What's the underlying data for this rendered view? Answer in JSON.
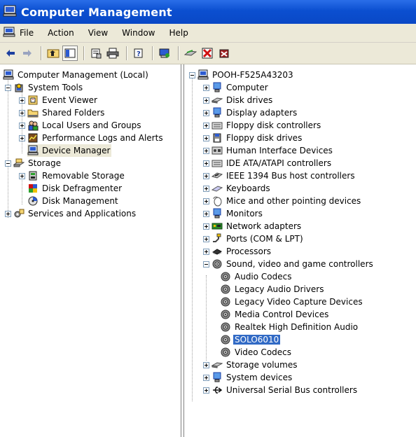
{
  "window": {
    "title": "Computer Management"
  },
  "menu": [
    "File",
    "Action",
    "View",
    "Window",
    "Help"
  ],
  "left_tree": [
    {
      "label": "Computer Management (Local)",
      "icon": "computer-icon",
      "expander": "none"
    },
    {
      "label": "System Tools",
      "icon": "system-tools-icon",
      "expander": "minus"
    },
    {
      "label": "Event Viewer",
      "icon": "event-viewer-icon",
      "expander": "plus"
    },
    {
      "label": "Shared Folders",
      "icon": "folder-icon",
      "expander": "plus"
    },
    {
      "label": "Local Users and Groups",
      "icon": "users-icon",
      "expander": "plus"
    },
    {
      "label": "Performance Logs and Alerts",
      "icon": "performance-icon",
      "expander": "plus"
    },
    {
      "label": "Device Manager",
      "icon": "device-manager-icon",
      "expander": "none",
      "selected": true
    },
    {
      "label": "Storage",
      "icon": "storage-icon",
      "expander": "minus"
    },
    {
      "label": "Removable Storage",
      "icon": "removable-storage-icon",
      "expander": "plus"
    },
    {
      "label": "Disk Defragmenter",
      "icon": "defrag-icon",
      "expander": "none"
    },
    {
      "label": "Disk Management",
      "icon": "disk-management-icon",
      "expander": "none"
    },
    {
      "label": "Services and Applications",
      "icon": "services-icon",
      "expander": "plus"
    }
  ],
  "right_tree": [
    {
      "label": "POOH-F525A43203",
      "icon": "computer-icon",
      "expander": "minus"
    },
    {
      "label": "Computer",
      "icon": "computer-icon",
      "expander": "plus"
    },
    {
      "label": "Disk drives",
      "icon": "disk-drive-icon",
      "expander": "plus"
    },
    {
      "label": "Display adapters",
      "icon": "display-icon",
      "expander": "plus"
    },
    {
      "label": "Floppy disk controllers",
      "icon": "controller-icon",
      "expander": "plus"
    },
    {
      "label": "Floppy disk drives",
      "icon": "floppy-icon",
      "expander": "plus"
    },
    {
      "label": "Human Interface Devices",
      "icon": "hid-icon",
      "expander": "plus"
    },
    {
      "label": "IDE ATA/ATAPI controllers",
      "icon": "controller-icon",
      "expander": "plus"
    },
    {
      "label": "IEEE 1394 Bus host controllers",
      "icon": "ieee-icon",
      "expander": "plus"
    },
    {
      "label": "Keyboards",
      "icon": "keyboard-icon",
      "expander": "plus"
    },
    {
      "label": "Mice and other pointing devices",
      "icon": "mouse-icon",
      "expander": "plus"
    },
    {
      "label": "Monitors",
      "icon": "monitor-icon",
      "expander": "plus"
    },
    {
      "label": "Network adapters",
      "icon": "network-icon",
      "expander": "plus"
    },
    {
      "label": "Ports (COM & LPT)",
      "icon": "port-icon",
      "expander": "plus"
    },
    {
      "label": "Processors",
      "icon": "processor-icon",
      "expander": "plus"
    },
    {
      "label": "Sound, video and game controllers",
      "icon": "speaker-icon",
      "expander": "minus"
    },
    {
      "label": "Audio Codecs",
      "icon": "speaker-icon",
      "expander": "none"
    },
    {
      "label": "Legacy Audio Drivers",
      "icon": "speaker-icon",
      "expander": "none"
    },
    {
      "label": "Legacy Video Capture Devices",
      "icon": "speaker-icon",
      "expander": "none"
    },
    {
      "label": "Media Control Devices",
      "icon": "speaker-icon",
      "expander": "none"
    },
    {
      "label": "Realtek High Definition Audio",
      "icon": "speaker-icon",
      "expander": "none"
    },
    {
      "label": "SOLO6010",
      "icon": "speaker-icon",
      "expander": "none",
      "selected": true
    },
    {
      "label": "Video Codecs",
      "icon": "speaker-icon",
      "expander": "none"
    },
    {
      "label": "Storage volumes",
      "icon": "disk-drive-icon",
      "expander": "plus"
    },
    {
      "label": "System devices",
      "icon": "computer-icon",
      "expander": "plus"
    },
    {
      "label": "Universal Serial Bus controllers",
      "icon": "usb-icon",
      "expander": "plus"
    }
  ],
  "toolbar_icons": [
    "back-arrow-icon",
    "forward-arrow-icon",
    "up-folder-icon",
    "show-hide-tree-icon",
    "properties-icon",
    "print-icon",
    "help-icon",
    "scan-hardware-icon",
    "disable-device-icon",
    "uninstall-device-icon",
    "update-driver-icon"
  ],
  "colors": {
    "titlebar": "#0a4ad0",
    "chrome": "#ece9d8",
    "selection": "#316ac5"
  }
}
